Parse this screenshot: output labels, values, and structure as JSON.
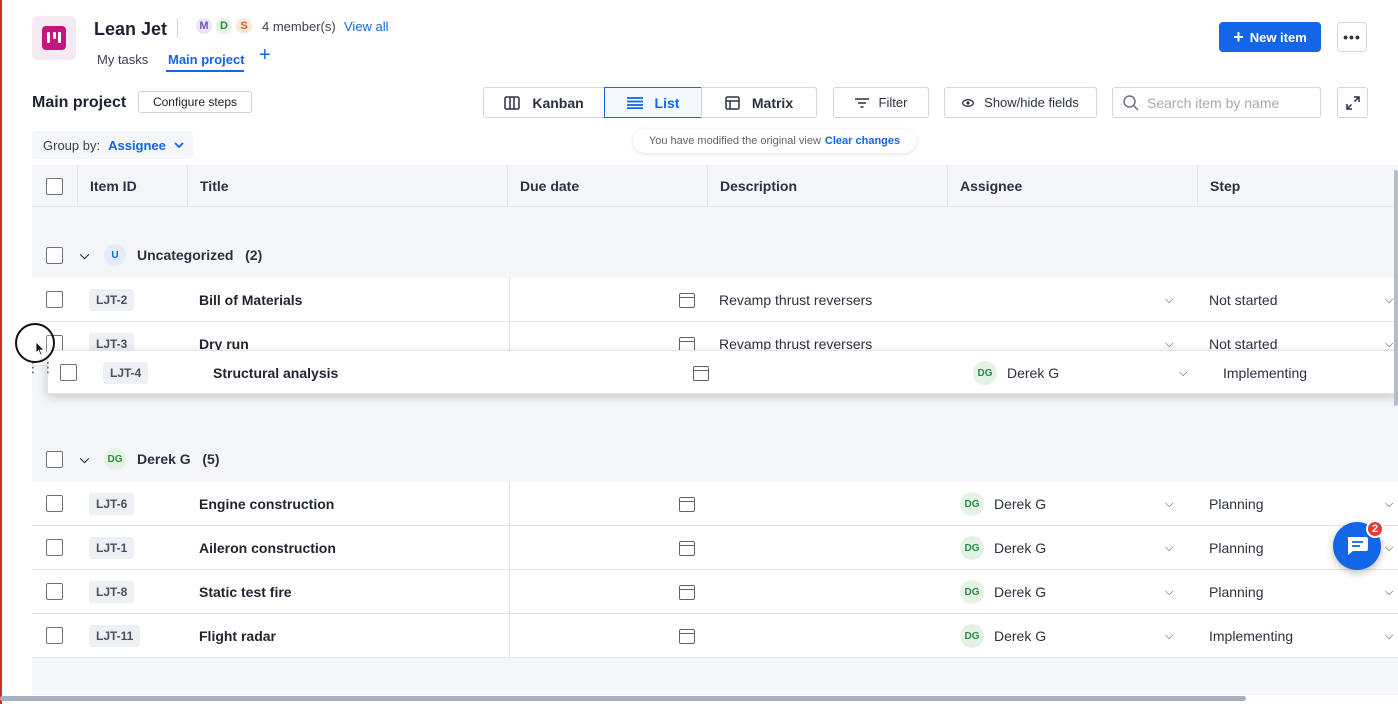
{
  "app": {
    "title": "Lean Jet",
    "members": [
      {
        "initial": "M",
        "bg": "#ece4f8",
        "fg": "#7a4fbf"
      },
      {
        "initial": "D",
        "bg": "#e3f4e6",
        "fg": "#2e8a43"
      },
      {
        "initial": "S",
        "bg": "#fde8dc",
        "fg": "#c8602a"
      }
    ],
    "members_text": "4 member(s)",
    "view_all": "View all",
    "tabs": [
      "My tasks",
      "Main project"
    ],
    "add_tab": "+",
    "new_item": "New item",
    "more": "•••"
  },
  "toolbar": {
    "page_title": "Main project",
    "configure": "Configure steps",
    "views": [
      "Kanban",
      "List",
      "Matrix"
    ],
    "filter": "Filter",
    "show_hide": "Show/hide fields",
    "search_placeholder": "Search item by name",
    "notice": "You have modified the original view",
    "clear_changes": "Clear changes",
    "group_by_label": "Group by:",
    "group_by_value": "Assignee"
  },
  "columns": [
    "Item ID",
    "Title",
    "Due date",
    "Description",
    "Assignee",
    "Step"
  ],
  "groups": [
    {
      "avatar": "U",
      "name": "Uncategorized",
      "count": "(2)",
      "rows": [
        {
          "id": "LJT-2",
          "title": "Bill of Materials",
          "description": "Revamp thrust reversers",
          "assignee": "",
          "step": "Not started"
        },
        {
          "id": "LJT-3",
          "title": "Dry run",
          "description": "Revamp thrust reversers",
          "assignee": "",
          "step": "Not started"
        }
      ]
    },
    {
      "avatar": "DG",
      "name": "Derek G",
      "count": "(5)",
      "rows": [
        {
          "id": "LJT-6",
          "title": "Engine construction",
          "description": "",
          "assignee": "Derek G",
          "step": "Planning"
        },
        {
          "id": "LJT-1",
          "title": "Aileron construction",
          "description": "",
          "assignee": "Derek G",
          "step": "Planning"
        },
        {
          "id": "LJT-8",
          "title": "Static test fire",
          "description": "",
          "assignee": "Derek G",
          "step": "Planning"
        },
        {
          "id": "LJT-11",
          "title": "Flight radar",
          "description": "",
          "assignee": "Derek G",
          "step": "Implementing"
        }
      ]
    }
  ],
  "dragged_row": {
    "id": "LJT-4",
    "title": "Structural analysis",
    "assignee_initials": "DG",
    "assignee": "Derek G",
    "step": "Implementing"
  },
  "chat": {
    "badge": "2"
  },
  "colors": {
    "accent": "#1466e8",
    "brand": "#c2187e"
  }
}
